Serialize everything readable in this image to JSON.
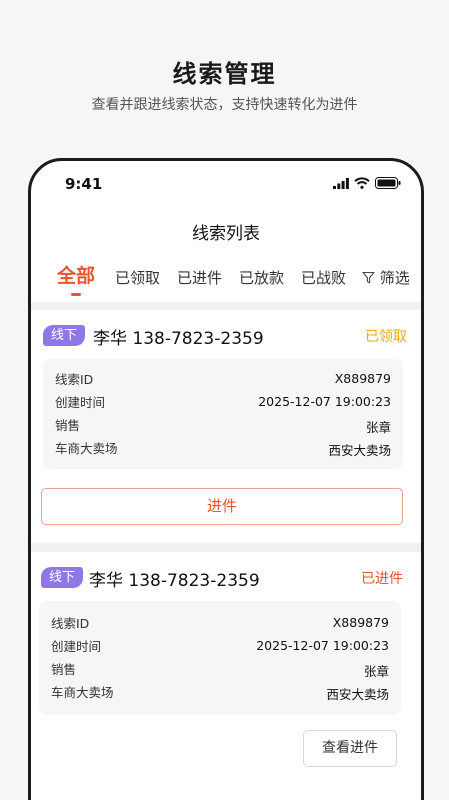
{
  "hero": {
    "title": "线索管理",
    "subtitle": "查看并跟进线索状态，支持快速转化为进件"
  },
  "status_bar": {
    "time": "9:41",
    "icons": [
      "signal-icon",
      "wifi-icon",
      "battery-icon"
    ]
  },
  "nav": {
    "title": "线索列表"
  },
  "tabs": [
    {
      "label": "全部",
      "active": true
    },
    {
      "label": "已领取"
    },
    {
      "label": "已进件"
    },
    {
      "label": "已放款"
    },
    {
      "label": "已战败"
    },
    {
      "label": "筛选",
      "icon": "filter-icon"
    }
  ],
  "cards": [
    {
      "tag": "线下",
      "name": "李华  138-7823-2359",
      "status": "已领取",
      "status_color": "#e6a817",
      "fields": [
        {
          "key": "线索ID",
          "value": "X889879"
        },
        {
          "key": "创建时间",
          "value": "2025-12-07 19:00:23"
        },
        {
          "key": "销售",
          "value": "张章"
        },
        {
          "key": "车商大卖场",
          "value": "西安大卖场"
        }
      ],
      "action": "进件"
    },
    {
      "tag": "线下",
      "name": "李华  138-7823-2359",
      "status": "已进件",
      "status_color": "#e8552b",
      "fields": [
        {
          "key": "线索ID",
          "value": "X889879"
        },
        {
          "key": "创建时间",
          "value": "2025-12-07 19:00:23"
        },
        {
          "key": "销售",
          "value": "张章"
        },
        {
          "key": "车商大卖场",
          "value": "西安大卖场"
        }
      ],
      "action": "查看进件"
    }
  ],
  "colors": {
    "accent": "#e8552b",
    "tag": "#8f78e6",
    "pending": "#e6a817"
  }
}
